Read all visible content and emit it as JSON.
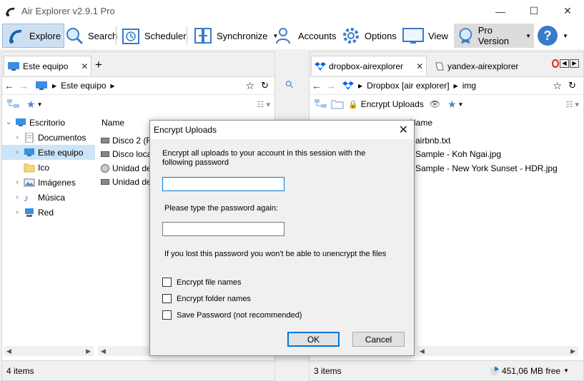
{
  "window": {
    "title": "Air Explorer v2.9.1 Pro",
    "min_glyph": "—",
    "max_glyph": "☐",
    "close_glyph": "✕"
  },
  "toolbar": {
    "explore": "Explore",
    "search": "Search",
    "scheduler": "Scheduler",
    "synchronize": "Synchronize",
    "accounts": "Accounts",
    "options": "Options",
    "view": "View",
    "pro_version": "Pro Version",
    "help_glyph": "?"
  },
  "left_panel": {
    "tab_label": "Este equipo",
    "add_tab": "+",
    "path": [
      "Este equipo"
    ],
    "tree": [
      {
        "label": "Escritorio",
        "icon": "desktop-icon"
      },
      {
        "label": "Documentos",
        "icon": "document-icon"
      },
      {
        "label": "Este equipo",
        "icon": "computer-icon"
      },
      {
        "label": "Ico",
        "icon": "folder-icon"
      },
      {
        "label": "Imágenes",
        "icon": "image-icon"
      },
      {
        "label": "Música",
        "icon": "music-icon"
      },
      {
        "label": "Red",
        "icon": "network-icon"
      }
    ],
    "column_name": "Name",
    "files": [
      "Disco 2 (F:",
      "Disco loca",
      "Unidad de",
      "Unidad de"
    ],
    "status": "4 items"
  },
  "right_panel": {
    "tab1_label": "dropbox-airexplorer",
    "tab2_label": "yandex-airexplorer",
    "path": [
      "Dropbox [air explorer]",
      "img"
    ],
    "encrypt_uploads": "Encrypt Uploads",
    "column_name": "Name",
    "files": [
      "airbnb.txt",
      "Sample - Koh Ngai.jpg",
      "Sample - New York Sunset - HDR.jpg"
    ],
    "status": "3 items",
    "free_space": "451,06 MB free"
  },
  "dialog": {
    "title": "Encrypt Uploads",
    "description": "Encrypt all uploads to your account in this session with the following password",
    "password_value": "",
    "retype_label": "Please type the password again:",
    "retype_value": "",
    "warning": "If you lost this password you won't be able to unencrypt the files",
    "check_filenames": "Encrypt file names",
    "check_foldernames": "Encrypt folder names",
    "check_save": "Save Password (not recommended)",
    "ok": "OK",
    "cancel": "Cancel"
  },
  "colors": {
    "accent": "#0078d7",
    "selection": "#cce4f7",
    "dropbox": "#0061fe"
  }
}
